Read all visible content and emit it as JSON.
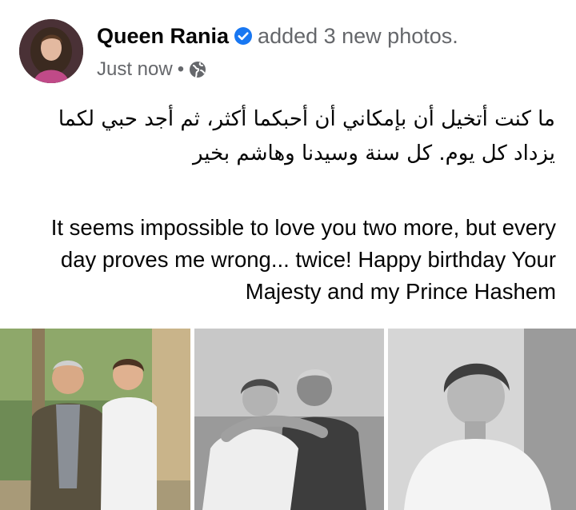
{
  "post": {
    "author_name": "Queen Rania",
    "action_text": "added 3 new photos.",
    "timestamp": "Just now",
    "separator": "•",
    "audience_icon": "globe-icon",
    "verified_icon": "verified-badge-icon",
    "verified_color": "#1877f2",
    "text_arabic": "ما كنت أتخيل أن بإمكاني أن أحبكما أكثر، ثم أجد حبي لكما يزداد كل يوم. كل سنة وسيدنا وهاشم بخير",
    "text_english": "It seems impossible to love you two more, but every day proves me wrong... twice! Happy birthday Your Majesty and my Prince Hashem",
    "photos": [
      {
        "name": "photo-1",
        "type": "color"
      },
      {
        "name": "photo-2",
        "type": "black-and-white"
      },
      {
        "name": "photo-3",
        "type": "black-and-white"
      }
    ]
  }
}
